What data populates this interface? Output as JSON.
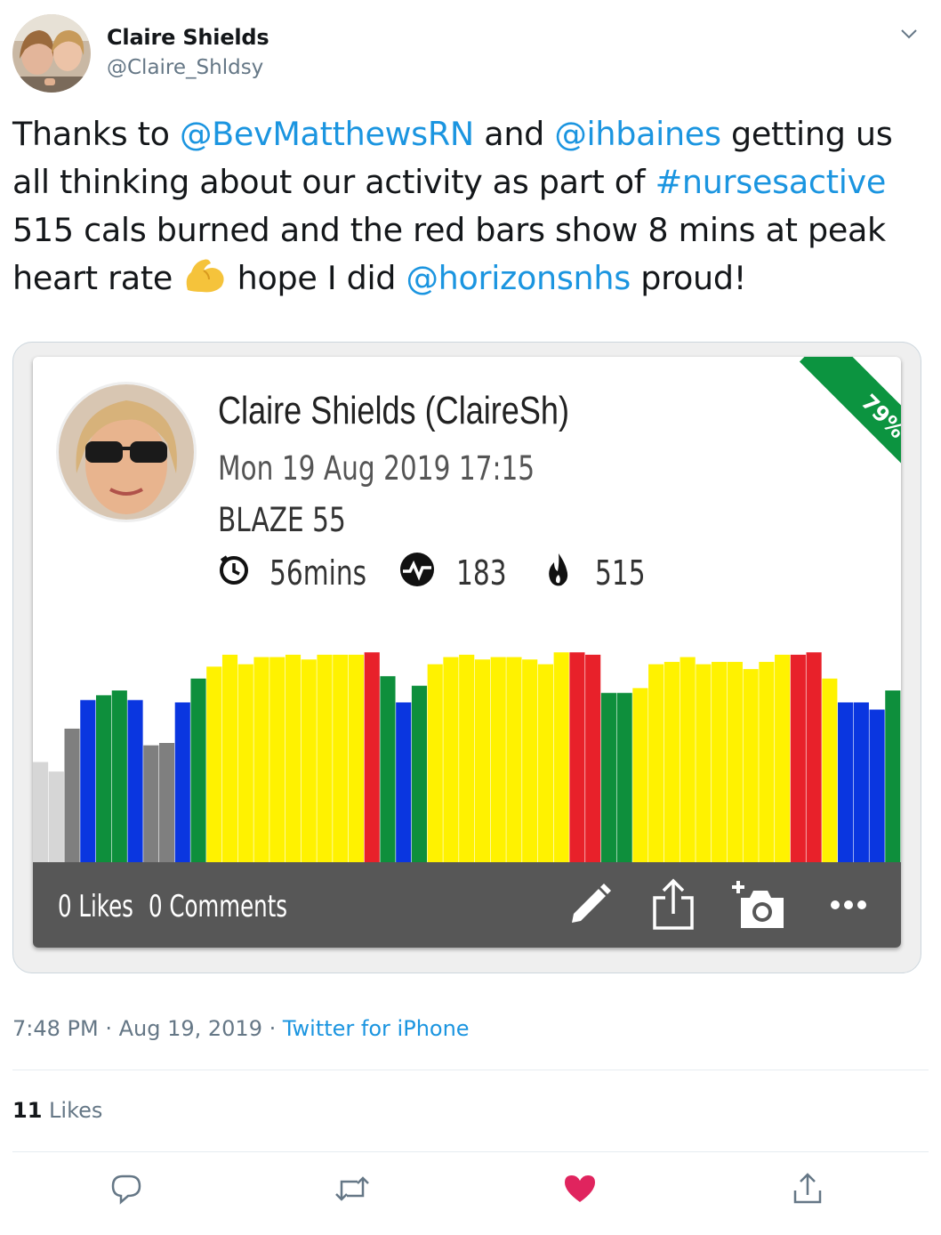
{
  "author": {
    "name": "Claire Shields",
    "handle": "@Claire_Shldsy"
  },
  "tweet": {
    "line1": {
      "pre": "Thanks to ",
      "m1": "@BevMatthewsRN",
      "mid": " and ",
      "m2": "@ihbaines",
      "post": " getting us"
    },
    "line2": {
      "pre": "all thinking about our activity as part of ",
      "tag": "#nursesactive"
    },
    "line3": "515 cals burned and the red bars show 8 mins at peak",
    "line4": {
      "pre": "heart rate ",
      "mid": " hope I did ",
      "m3": "@horizonsnhs",
      "post": " proud!"
    }
  },
  "card": {
    "name": "Claire Shields (ClaireSh)",
    "date": "Mon 19 Aug 2019 17:15",
    "class": "BLAZE 55",
    "duration": "56mins",
    "heart": "183",
    "calories": "515",
    "ribbon": "79%",
    "likes": "0 Likes",
    "comments": "0 Comments"
  },
  "chart_data": {
    "type": "bar",
    "colors": {
      "lightgray": "#d6d6d6",
      "gray": "#7f7f7f",
      "blue": "#0a36e0",
      "green": "#0e8f3c",
      "yellow": "#fff200",
      "red": "#e8212a"
    },
    "bars": [
      {
        "v": 42,
        "c": "lightgray"
      },
      {
        "v": 38,
        "c": "lightgray"
      },
      {
        "v": 56,
        "c": "gray"
      },
      {
        "v": 68,
        "c": "blue"
      },
      {
        "v": 70,
        "c": "green"
      },
      {
        "v": 72,
        "c": "green"
      },
      {
        "v": 68,
        "c": "blue"
      },
      {
        "v": 49,
        "c": "gray"
      },
      {
        "v": 50,
        "c": "gray"
      },
      {
        "v": 67,
        "c": "blue"
      },
      {
        "v": 77,
        "c": "green"
      },
      {
        "v": 82,
        "c": "yellow"
      },
      {
        "v": 87,
        "c": "yellow"
      },
      {
        "v": 83,
        "c": "yellow"
      },
      {
        "v": 86,
        "c": "yellow"
      },
      {
        "v": 86,
        "c": "yellow"
      },
      {
        "v": 87,
        "c": "yellow"
      },
      {
        "v": 85,
        "c": "yellow"
      },
      {
        "v": 87,
        "c": "yellow"
      },
      {
        "v": 87,
        "c": "yellow"
      },
      {
        "v": 87,
        "c": "yellow"
      },
      {
        "v": 88,
        "c": "red"
      },
      {
        "v": 78,
        "c": "green"
      },
      {
        "v": 67,
        "c": "blue"
      },
      {
        "v": 74,
        "c": "green"
      },
      {
        "v": 83,
        "c": "yellow"
      },
      {
        "v": 86,
        "c": "yellow"
      },
      {
        "v": 87,
        "c": "yellow"
      },
      {
        "v": 85,
        "c": "yellow"
      },
      {
        "v": 86,
        "c": "yellow"
      },
      {
        "v": 86,
        "c": "yellow"
      },
      {
        "v": 85,
        "c": "yellow"
      },
      {
        "v": 83,
        "c": "yellow"
      },
      {
        "v": 88,
        "c": "yellow"
      },
      {
        "v": 88,
        "c": "red"
      },
      {
        "v": 87,
        "c": "red"
      },
      {
        "v": 71,
        "c": "green"
      },
      {
        "v": 71,
        "c": "green"
      },
      {
        "v": 73,
        "c": "yellow"
      },
      {
        "v": 83,
        "c": "yellow"
      },
      {
        "v": 84,
        "c": "yellow"
      },
      {
        "v": 86,
        "c": "yellow"
      },
      {
        "v": 83,
        "c": "yellow"
      },
      {
        "v": 84,
        "c": "yellow"
      },
      {
        "v": 84,
        "c": "yellow"
      },
      {
        "v": 81,
        "c": "yellow"
      },
      {
        "v": 84,
        "c": "yellow"
      },
      {
        "v": 87,
        "c": "yellow"
      },
      {
        "v": 87,
        "c": "red"
      },
      {
        "v": 88,
        "c": "red"
      },
      {
        "v": 77,
        "c": "yellow"
      },
      {
        "v": 67,
        "c": "blue"
      },
      {
        "v": 67,
        "c": "blue"
      },
      {
        "v": 64,
        "c": "blue"
      },
      {
        "v": 72,
        "c": "green"
      }
    ]
  },
  "meta": {
    "time": "7:48 PM",
    "sep1": " · ",
    "date": "Aug 19, 2019",
    "sep2": " · ",
    "source": "Twitter for iPhone"
  },
  "likes": {
    "count": "11",
    "label": " Likes"
  }
}
